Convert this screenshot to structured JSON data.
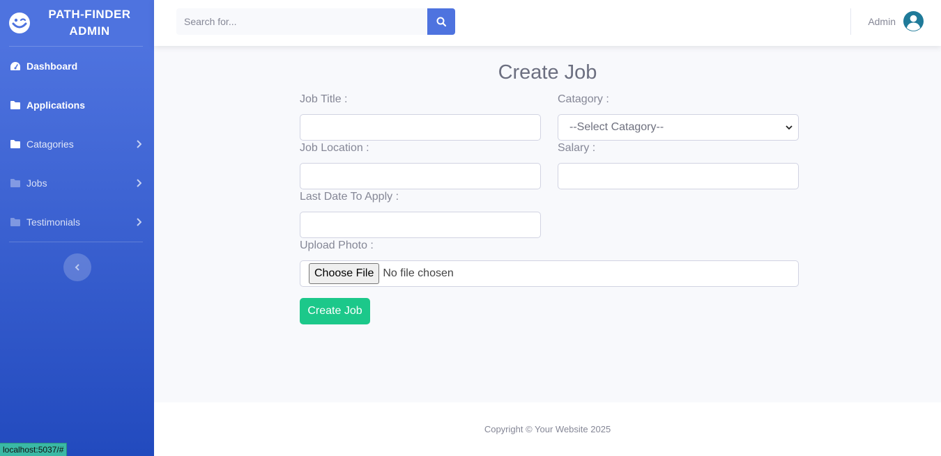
{
  "sidebar": {
    "brand": "PATH-FINDER ADMIN",
    "items": [
      {
        "label": "Dashboard",
        "icon": "tachometer-icon"
      },
      {
        "label": "Applications",
        "icon": "folder-icon"
      },
      {
        "label": "Catagories",
        "icon": "folder-icon"
      },
      {
        "label": "Jobs",
        "icon": "folder-icon"
      },
      {
        "label": "Testimonials",
        "icon": "folder-icon"
      }
    ]
  },
  "topbar": {
    "search_placeholder": "Search for...",
    "user_name": "Admin"
  },
  "form": {
    "title": "Create Job",
    "job_title_label": "Job Title :",
    "job_title_value": "",
    "category_label": "Catagory :",
    "category_selected": "--Select Catagory--",
    "location_label": "Job Location :",
    "location_value": "",
    "salary_label": "Salary :",
    "salary_value": "",
    "last_date_label": "Last Date To Apply :",
    "last_date_value": "",
    "photo_label": "Upload Photo :",
    "file_button": "Choose File",
    "file_status": "No file chosen",
    "submit_label": "Create Job"
  },
  "footer": {
    "copyright": "Copyright © Your Website 2025"
  },
  "status_bar": {
    "url": "localhost:5037/#"
  },
  "colors": {
    "primary": "#4e73df",
    "success": "#1cc88a",
    "text_muted": "#858796"
  }
}
